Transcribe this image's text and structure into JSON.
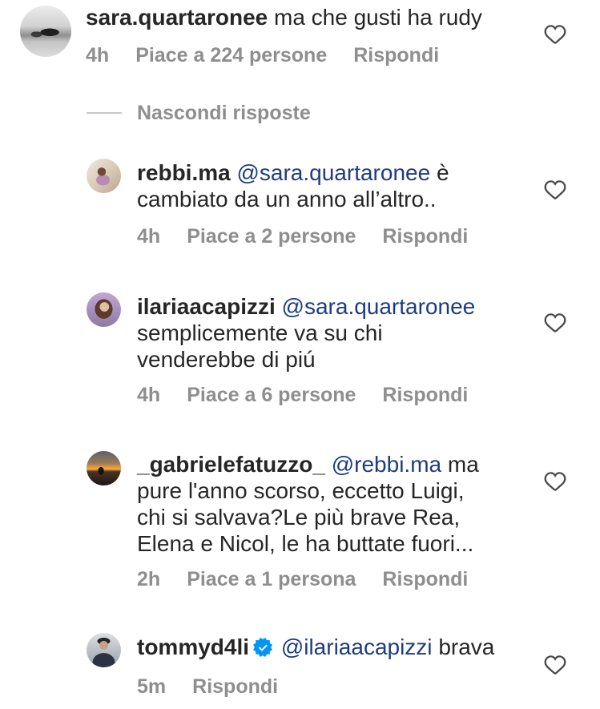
{
  "colors": {
    "text": "#262626",
    "meta": "#8e8e8e",
    "mention": "#1e3c82",
    "verified": "#0095f6",
    "heart": "#4a4a4a",
    "divider": "#c7c7c7",
    "background": "#ffffff"
  },
  "icons": {
    "like": "heart-icon",
    "verified": "verified-badge-icon"
  },
  "comment": {
    "username": "sara.quartaronee",
    "text": "ma che gusti ha rudy",
    "time": "4h",
    "likes": "Piace a 224 persone",
    "reply_label": "Rispondi"
  },
  "hide_replies_label": "Nascondi risposte",
  "replies": [
    {
      "username": "rebbi.ma",
      "mention": "@sara.quartaronee",
      "text": "è\ncambiato da un anno all’altro..",
      "time": "4h",
      "likes": "Piace a 2 persone",
      "reply_label": "Rispondi"
    },
    {
      "username": "ilariaacapizzi",
      "mention": "@sara.quartaronee",
      "text": "semplicemente va su chi\nvenderebbe di piú",
      "time": "4h",
      "likes": "Piace a 6 persone",
      "reply_label": "Rispondi"
    },
    {
      "username": "_gabrielefatuzzo_",
      "mention": "@rebbi.ma",
      "text": "ma\npure l'anno scorso, eccetto Luigi,\nchi si salvava?Le più brave Rea,\nElena e Nicol, le ha buttate fuori...",
      "time": "2h",
      "likes": "Piace a 1 persona",
      "reply_label": "Rispondi"
    },
    {
      "username": "tommyd4li",
      "verified": true,
      "mention": "@ilariaacapizzi",
      "text": "brava",
      "time": "5m",
      "reply_label": "Rispondi"
    }
  ]
}
